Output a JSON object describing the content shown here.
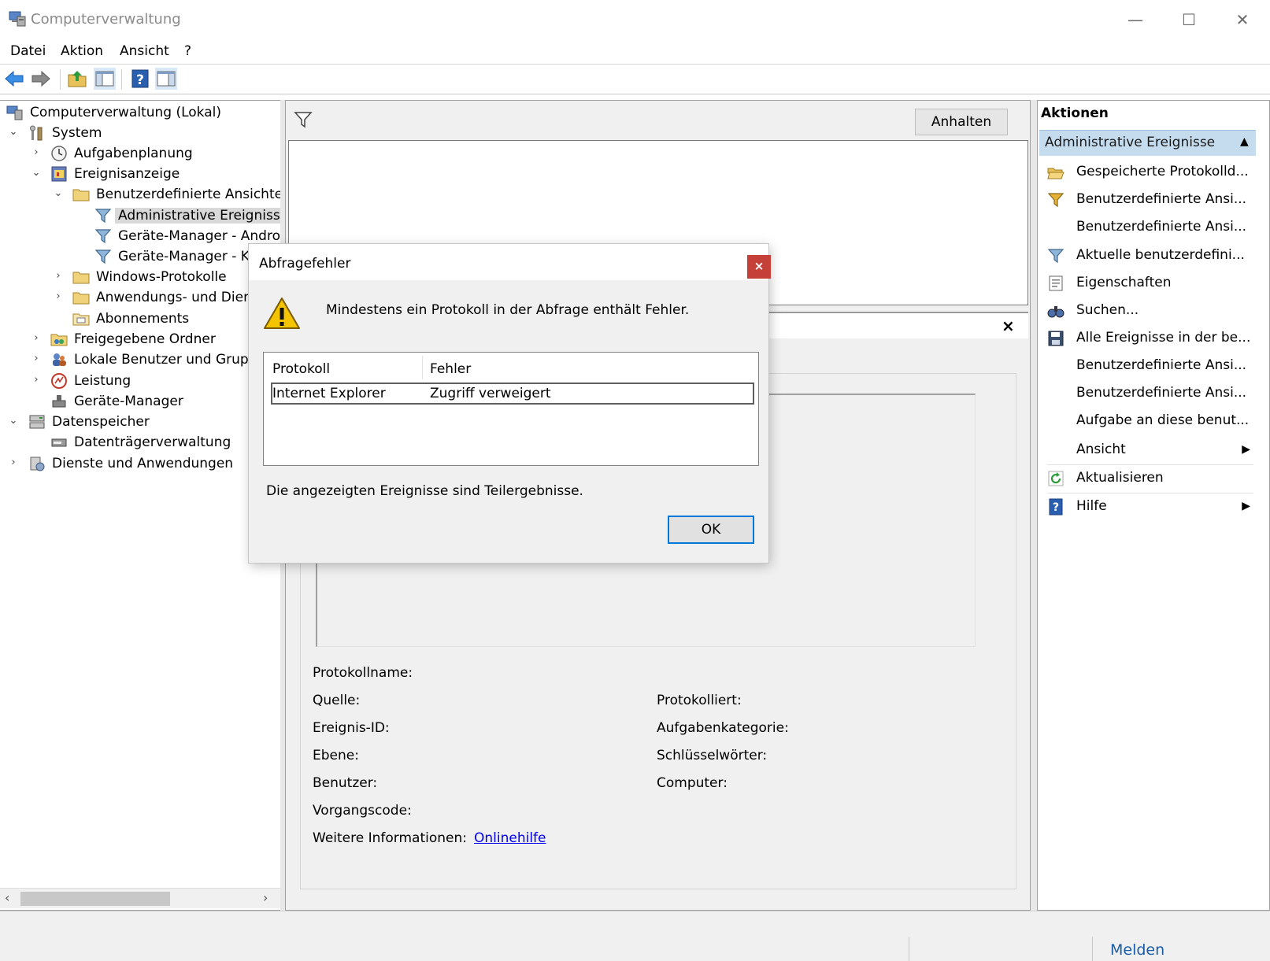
{
  "window": {
    "title": "Computerverwaltung",
    "minimize": "—",
    "maximize": "☐",
    "close": "✕"
  },
  "menu": [
    "Datei",
    "Aktion",
    "Ansicht",
    "?"
  ],
  "toolbar": [
    "back-arrow-icon",
    "forward-arrow-icon",
    "up-folder-icon",
    "show-hide-tree-icon",
    "help-icon",
    "show-hide-action-pane-icon"
  ],
  "tree": [
    {
      "label": "Computerverwaltung (Lokal)",
      "chevron": "",
      "icon": "computer-management-icon"
    },
    {
      "label": "System",
      "chevron": "⌄",
      "icon": "system-tools-icon"
    },
    {
      "label": "Aufgabenplanung",
      "chevron": "›",
      "icon": "clock-icon"
    },
    {
      "label": "Ereignisanzeige",
      "chevron": "⌄",
      "icon": "event-viewer-icon"
    },
    {
      "label": "Benutzerdefinierte Ansichten",
      "chevron": "⌄",
      "icon": "folder-icon"
    },
    {
      "label": "Administrative Ereignisse",
      "chevron": "",
      "icon": "filter-icon",
      "selected": true
    },
    {
      "label": "Geräte-Manager - Android",
      "chevron": "",
      "icon": "filter-icon"
    },
    {
      "label": "Geräte-Manager - KD",
      "chevron": "",
      "icon": "filter-icon"
    },
    {
      "label": "Windows-Protokolle",
      "chevron": "›",
      "icon": "folder-icon"
    },
    {
      "label": "Anwendungs- und Diens",
      "chevron": "›",
      "icon": "folder-icon"
    },
    {
      "label": "Abonnements",
      "chevron": "",
      "icon": "subscriptions-icon"
    },
    {
      "label": "Freigegebene Ordner",
      "chevron": "›",
      "icon": "shared-folder-icon"
    },
    {
      "label": "Lokale Benutzer und Gruppe",
      "chevron": "›",
      "icon": "users-icon"
    },
    {
      "label": "Leistung",
      "chevron": "›",
      "icon": "performance-icon"
    },
    {
      "label": "Geräte-Manager",
      "chevron": "",
      "icon": "device-manager-icon"
    },
    {
      "label": "Datenspeicher",
      "chevron": "⌄",
      "icon": "storage-icon"
    },
    {
      "label": "Datenträgerverwaltung",
      "chevron": "",
      "icon": "disk-icon"
    },
    {
      "label": "Dienste und Anwendungen",
      "chevron": "›",
      "icon": "services-icon"
    }
  ],
  "middle": {
    "anhalten_label": "Anhalten",
    "detail_close": "×",
    "properties": {
      "protokollname": "Protokollname:",
      "quelle": "Quelle:",
      "ereignis_id": "Ereignis-ID:",
      "ebene": "Ebene:",
      "benutzer": "Benutzer:",
      "vorgangscode": "Vorgangscode:",
      "weitere": "Weitere Informationen:",
      "onlinehilfe": "Onlinehilfe",
      "protokolliert": "Protokolliert:",
      "aufgabenkategorie": "Aufgabenkategorie:",
      "schluesselwoerter": "Schlüsselwörter:",
      "computer": "Computer:"
    }
  },
  "actions": {
    "title": "Aktionen",
    "section": "Administrative Ereignisse",
    "caret": "▲",
    "items": [
      {
        "label": "Gespeicherte Protokolld...",
        "icon": "open-folder-icon",
        "submenu": ""
      },
      {
        "label": "Benutzerdefinierte Ansi...",
        "icon": "filter-star-icon",
        "submenu": ""
      },
      {
        "label": "Benutzerdefinierte Ansi...",
        "icon": "",
        "submenu": ""
      },
      {
        "label": "Aktuelle benutzerdefini...",
        "icon": "filter-icon",
        "submenu": ""
      },
      {
        "label": "Eigenschaften",
        "icon": "properties-icon",
        "submenu": ""
      },
      {
        "label": "Suchen...",
        "icon": "binoculars-icon",
        "submenu": ""
      },
      {
        "label": "Alle Ereignisse in der be...",
        "icon": "save-icon",
        "submenu": ""
      },
      {
        "label": "Benutzerdefinierte Ansi...",
        "icon": "",
        "submenu": ""
      },
      {
        "label": "Benutzerdefinierte Ansi...",
        "icon": "",
        "submenu": ""
      },
      {
        "label": "Aufgabe an diese benut...",
        "icon": "",
        "submenu": ""
      },
      {
        "label": "Ansicht",
        "icon": "",
        "submenu": "▶"
      },
      {
        "label": "Aktualisieren",
        "icon": "refresh-icon",
        "submenu": ""
      },
      {
        "label": "Hilfe",
        "icon": "help-icon",
        "submenu": "▶"
      }
    ]
  },
  "dialog": {
    "title": "Abfragefehler",
    "close": "×",
    "message": "Mindestens ein Protokoll in der Abfrage enthält Fehler.",
    "columns": [
      "Protokoll",
      "Fehler"
    ],
    "rows": [
      [
        "Internet Explorer",
        "Zugriff verweigert"
      ]
    ],
    "footnote": "Die angezeigten Ereignisse sind Teilergebnisse.",
    "ok_label": "OK"
  },
  "statusbar": {
    "melden": "Melden"
  }
}
